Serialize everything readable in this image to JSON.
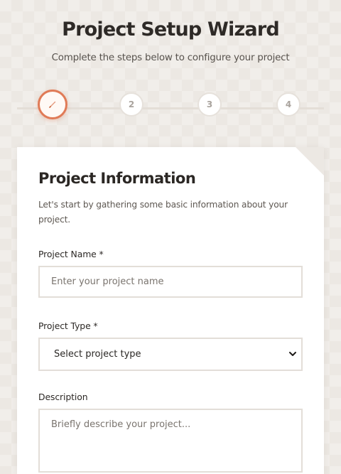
{
  "header": {
    "title": "Project Setup Wizard",
    "subtitle": "Complete the steps below to configure your project"
  },
  "stepper": {
    "active_step": 1,
    "active_icon": "pencil-icon",
    "steps": [
      "",
      "2",
      "3",
      "4"
    ]
  },
  "card": {
    "title": "Project Information",
    "description": "Let's start by gathering some basic information about your project."
  },
  "form": {
    "project_name": {
      "label": "Project Name *",
      "value": "",
      "placeholder": "Enter your project name"
    },
    "project_type": {
      "label": "Project Type *",
      "selected": "Select project type"
    },
    "description": {
      "label": "Description",
      "value": "",
      "placeholder": "Briefly describe your project..."
    }
  },
  "colors": {
    "accent": "#e07b57",
    "background": "#f1eeea",
    "card": "#ffffff",
    "border": "#e3ded8"
  }
}
